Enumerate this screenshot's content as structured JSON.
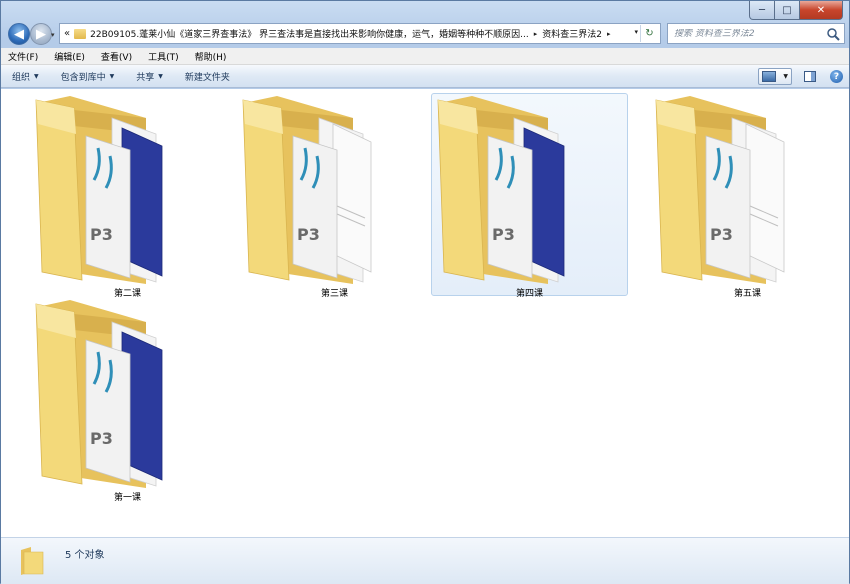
{
  "window": {
    "caption_min": "─",
    "caption_max": "□",
    "caption_close": "✕"
  },
  "nav": {
    "back_glyph": "◀",
    "forward_glyph": "▶",
    "history_glyph": "▾"
  },
  "address": {
    "overflow": "«",
    "path_main": "22B09105.蓬莱小仙《道家三界查事法》 界三查法事是直接找出来影响你健康，运气，婚姻等种种不顺原因...",
    "path_leaf": "资料查三界法2",
    "sep_glyph": "▸",
    "dropdown_glyph": "▾",
    "refresh_glyph": "↻"
  },
  "search": {
    "placeholder": "搜索 资料查三界法2"
  },
  "menu": [
    "文件(F)",
    "编辑(E)",
    "查看(V)",
    "工具(T)",
    "帮助(H)"
  ],
  "toolbar": {
    "organize": "组织",
    "include_in_library": "包含到库中",
    "share": "共享",
    "new_folder": "新建文件夹",
    "arrow": "▼",
    "help": "?"
  },
  "items": [
    {
      "label": "第二课",
      "front_sheet": "blue",
      "selected": false
    },
    {
      "label": "第三课",
      "front_sheet": "white",
      "selected": false
    },
    {
      "label": "第四课",
      "front_sheet": "blue",
      "selected": true
    },
    {
      "label": "第五课",
      "front_sheet": "white",
      "selected": false
    },
    {
      "label": "第一课",
      "front_sheet": "blue",
      "selected": false
    }
  ],
  "folder_doc_text": "P3",
  "status": {
    "count_text": "5 个对象"
  },
  "colors": {
    "folder_front": "#f3d97a",
    "folder_back": "#e7c25d",
    "doc_blue": "#2b3a9c",
    "selection": "#e4eef9"
  }
}
